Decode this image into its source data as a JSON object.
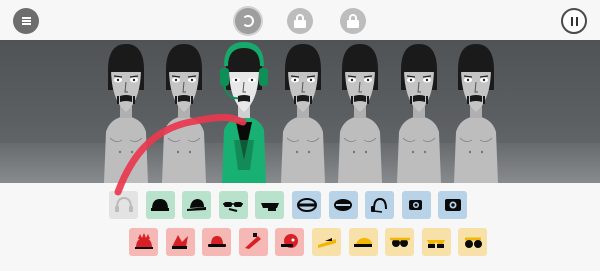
{
  "topbar": {
    "menu_icon": "menu-icon",
    "bonus_icon": "bonus-swirl-icon",
    "locked_icons": [
      "lock-icon",
      "lock-icon"
    ],
    "pause_icon": "pause-icon"
  },
  "stage": {
    "performers": [
      {
        "state": "idle",
        "skin": "#b4b4b4"
      },
      {
        "state": "idle",
        "skin": "#b4b4b4"
      },
      {
        "state": "active",
        "costume": "green-headphones-mic",
        "accent": "#19b173"
      },
      {
        "state": "idle",
        "skin": "#b4b4b4"
      },
      {
        "state": "idle",
        "skin": "#b4b4b4"
      },
      {
        "state": "idle",
        "skin": "#b4b4b4"
      },
      {
        "state": "idle",
        "skin": "#b4b4b4"
      }
    ],
    "drag_trail_color": "#e9384f"
  },
  "palette": {
    "row1": [
      {
        "category": "used",
        "icon": "headphones-icon"
      },
      {
        "category": "beats",
        "icon": "cap-icon"
      },
      {
        "category": "beats",
        "icon": "cap-side-icon"
      },
      {
        "category": "beats",
        "icon": "goggles-icon"
      },
      {
        "category": "beats",
        "icon": "visor-icon"
      },
      {
        "category": "effects",
        "icon": "headband-icon"
      },
      {
        "category": "effects",
        "icon": "glasses-band-icon"
      },
      {
        "category": "effects",
        "icon": "headset-icon"
      },
      {
        "category": "effects",
        "icon": "eye-visor-icon"
      },
      {
        "category": "effects",
        "icon": "camera-visor-icon"
      }
    ],
    "row2": [
      {
        "category": "melodies",
        "icon": "spiky-hat-icon"
      },
      {
        "category": "melodies",
        "icon": "jester-hat-icon"
      },
      {
        "category": "melodies",
        "icon": "bowler-hat-icon"
      },
      {
        "category": "melodies",
        "icon": "party-hat-icon"
      },
      {
        "category": "melodies",
        "icon": "round-cap-icon"
      },
      {
        "category": "voices",
        "icon": "straw-hat-icon"
      },
      {
        "category": "voices",
        "icon": "flat-cap-icon"
      },
      {
        "category": "voices",
        "icon": "sunglasses-icon"
      },
      {
        "category": "voices",
        "icon": "shades-icon"
      },
      {
        "category": "voices",
        "icon": "round-glasses-icon"
      }
    ],
    "colors": {
      "used": "#e3e3e3",
      "beats": "#b8e2cc",
      "effects": "#b8d3e8",
      "melodies": "#f5b8b4",
      "voices": "#f8e0a9"
    }
  }
}
